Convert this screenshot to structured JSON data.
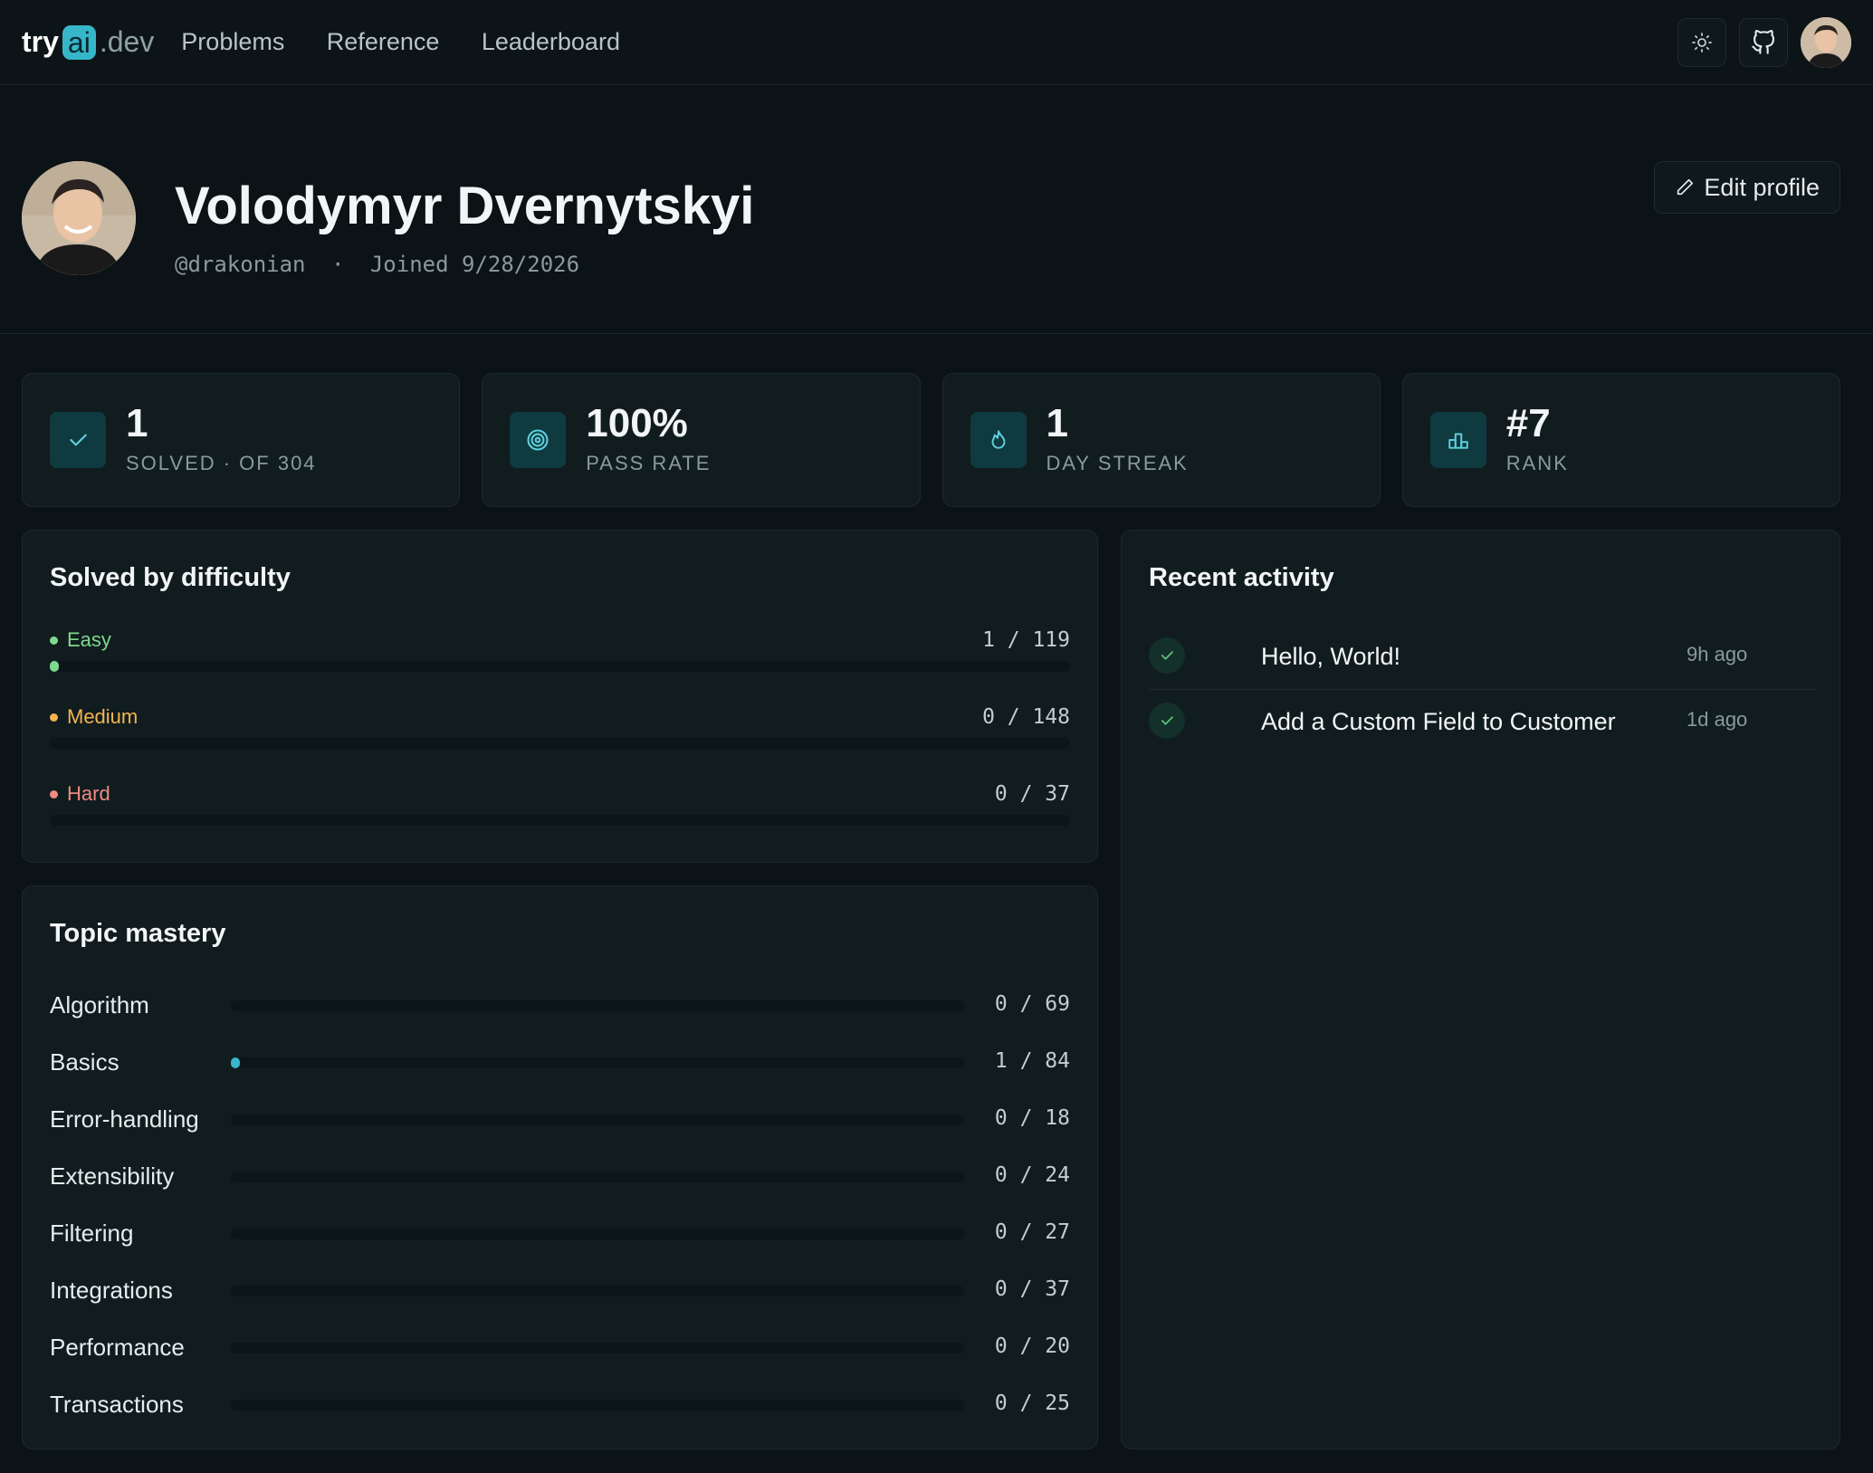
{
  "nav": {
    "logo_try": "try",
    "logo_ai": "ai",
    "logo_dev": ".dev",
    "links": [
      "Problems",
      "Reference",
      "Leaderboard"
    ],
    "theme_icon": "sun-icon",
    "github_icon": "github-icon"
  },
  "profile": {
    "name": "Volodymyr Dvernytskyi",
    "handle": "@drakonian",
    "separator": "·",
    "joined": "Joined 9/28/2026",
    "edit_label": "Edit profile"
  },
  "stats": [
    {
      "value": "1",
      "label": "SOLVED · OF 304",
      "icon": "check-icon"
    },
    {
      "value": "100%",
      "label": "PASS RATE",
      "icon": "target-icon"
    },
    {
      "value": "1",
      "label": "DAY STREAK",
      "icon": "flame-icon"
    },
    {
      "value": "#7",
      "label": "RANK",
      "icon": "podium-icon"
    }
  ],
  "difficulty": {
    "title": "Solved by difficulty",
    "rows": [
      {
        "label": "Easy",
        "solved": "1",
        "total": "119",
        "count_text": "1 / 119",
        "color": "#7fd98f",
        "fraction": 0.0084
      },
      {
        "label": "Medium",
        "solved": "0",
        "total": "148",
        "count_text": "0 / 148",
        "color": "#f3b54e",
        "fraction": 0
      },
      {
        "label": "Hard",
        "solved": "0",
        "total": "37",
        "count_text": "0 / 37",
        "color": "#f08a80",
        "fraction": 0
      }
    ]
  },
  "topics": {
    "title": "Topic mastery",
    "rows": [
      {
        "name": "Algorithm",
        "count_text": "0 / 69",
        "fraction": 0
      },
      {
        "name": "Basics",
        "count_text": "1 / 84",
        "fraction": 0.0119
      },
      {
        "name": "Error-handling",
        "count_text": "0 / 18",
        "fraction": 0
      },
      {
        "name": "Extensibility",
        "count_text": "0 / 24",
        "fraction": 0
      },
      {
        "name": "Filtering",
        "count_text": "0 / 27",
        "fraction": 0
      },
      {
        "name": "Integrations",
        "count_text": "0 / 37",
        "fraction": 0
      },
      {
        "name": "Performance",
        "count_text": "0 / 20",
        "fraction": 0
      },
      {
        "name": "Transactions",
        "count_text": "0 / 25",
        "fraction": 0
      }
    ]
  },
  "activity": {
    "title": "Recent activity",
    "items": [
      {
        "title": "Hello, World!",
        "ago": "9h ago"
      },
      {
        "title": "Add a Custom Field to Customer",
        "ago": "1d ago"
      }
    ]
  },
  "colors": {
    "accent": "#36b6c9",
    "background": "#0b1316",
    "card": "#111c1f"
  }
}
